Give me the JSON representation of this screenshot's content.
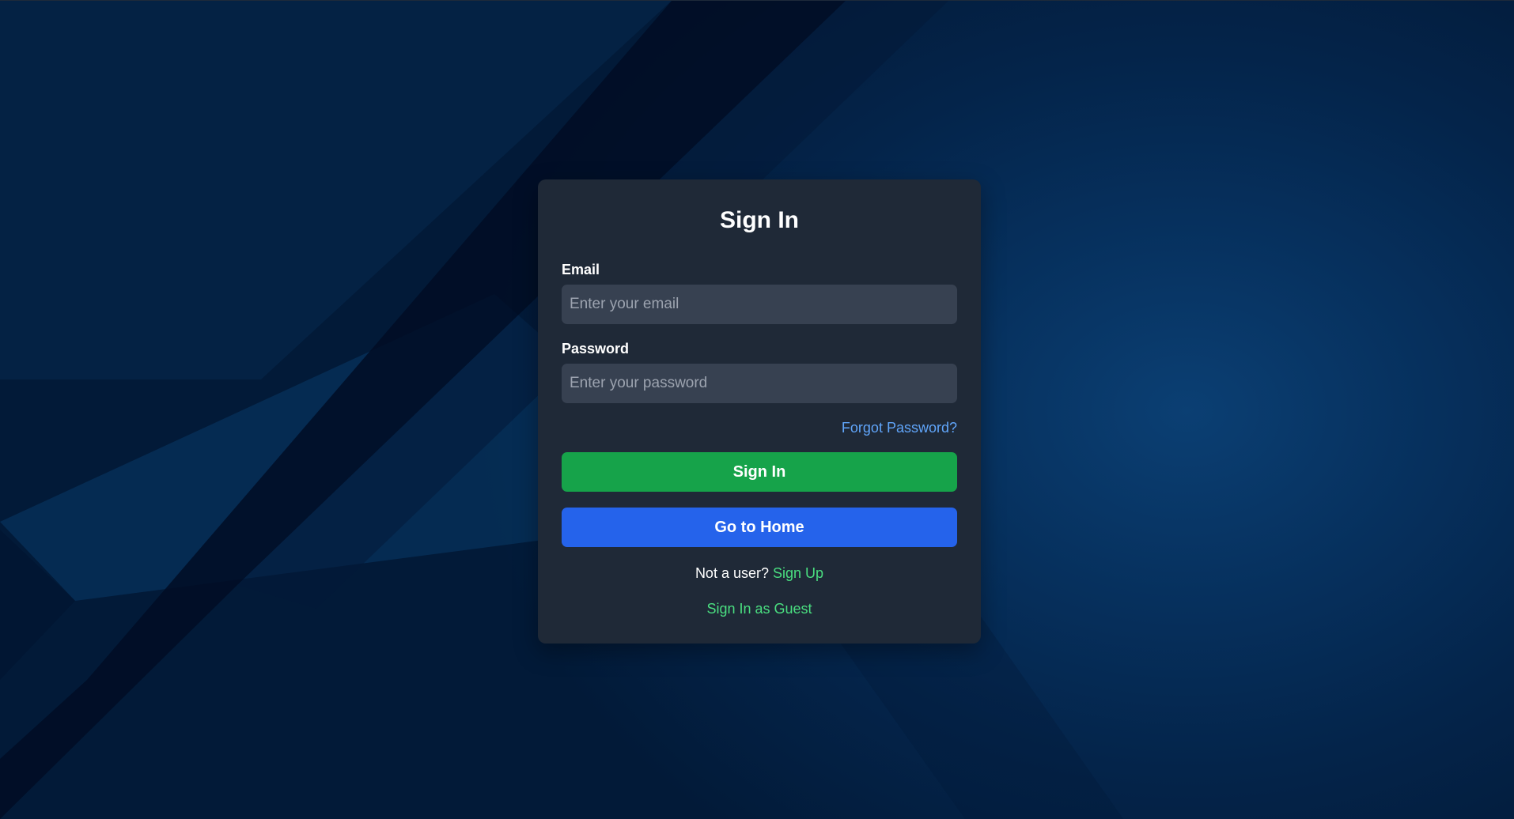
{
  "login": {
    "title": "Sign In",
    "email": {
      "label": "Email",
      "placeholder": "Enter your email",
      "value": ""
    },
    "password": {
      "label": "Password",
      "placeholder": "Enter your password",
      "value": ""
    },
    "forgot_password_link": "Forgot Password?",
    "sign_in_button": "Sign In",
    "go_home_button": "Go to Home",
    "signup_prompt": "Not a user?",
    "signup_link": "Sign Up",
    "guest_link": "Sign In as Guest"
  },
  "colors": {
    "card_background": "#1f2937",
    "input_background": "#374151",
    "sign_in_button": "#16a34a",
    "go_home_button": "#2563eb",
    "forgot_link": "#60a5fa",
    "green_link": "#4ade80",
    "page_background": "#04244a"
  }
}
